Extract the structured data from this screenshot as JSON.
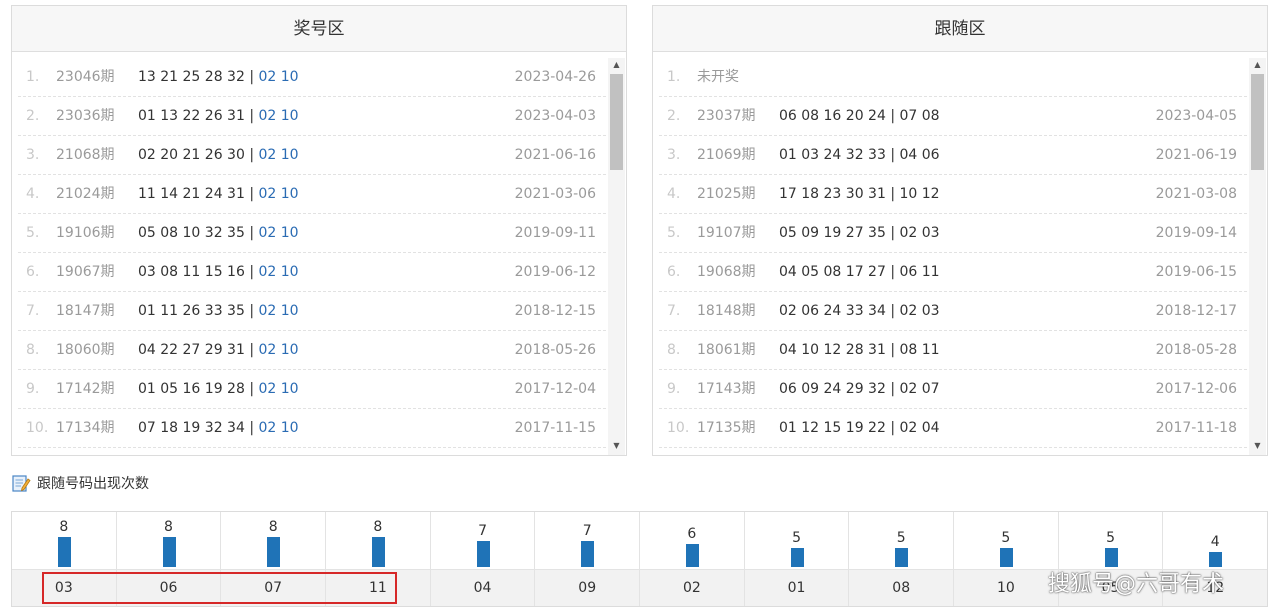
{
  "left_panel": {
    "title": "奖号区",
    "rows": [
      {
        "idx": "1.",
        "issue": "23046期",
        "front": "13 21 25 28 32 | ",
        "back": "02 10",
        "date": "2023-04-26"
      },
      {
        "idx": "2.",
        "issue": "23036期",
        "front": "01 13 22 26 31 | ",
        "back": "02 10",
        "date": "2023-04-03"
      },
      {
        "idx": "3.",
        "issue": "21068期",
        "front": "02 20 21 26 30 | ",
        "back": "02 10",
        "date": "2021-06-16"
      },
      {
        "idx": "4.",
        "issue": "21024期",
        "front": "11 14 21 24 31 | ",
        "back": "02 10",
        "date": "2021-03-06"
      },
      {
        "idx": "5.",
        "issue": "19106期",
        "front": "05 08 10 32 35 | ",
        "back": "02 10",
        "date": "2019-09-11"
      },
      {
        "idx": "6.",
        "issue": "19067期",
        "front": "03 08 11 15 16 | ",
        "back": "02 10",
        "date": "2019-06-12"
      },
      {
        "idx": "7.",
        "issue": "18147期",
        "front": "01 11 26 33 35 | ",
        "back": "02 10",
        "date": "2018-12-15"
      },
      {
        "idx": "8.",
        "issue": "18060期",
        "front": "04 22 27 29 31 | ",
        "back": "02 10",
        "date": "2018-05-26"
      },
      {
        "idx": "9.",
        "issue": "17142期",
        "front": "01 05 16 19 28 | ",
        "back": "02 10",
        "date": "2017-12-04"
      },
      {
        "idx": "10.",
        "issue": "17134期",
        "front": "07 18 19 32 34 | ",
        "back": "02 10",
        "date": "2017-11-15"
      }
    ]
  },
  "right_panel": {
    "title": "跟随区",
    "pending_row": {
      "idx": "1.",
      "text": "未开奖"
    },
    "rows": [
      {
        "idx": "2.",
        "issue": "23037期",
        "numbers": "06 08 16 20 24 | 07 08",
        "date": "2023-04-05"
      },
      {
        "idx": "3.",
        "issue": "21069期",
        "numbers": "01 03 24 32 33 | 04 06",
        "date": "2021-06-19"
      },
      {
        "idx": "4.",
        "issue": "21025期",
        "numbers": "17 18 23 30 31 | 10 12",
        "date": "2021-03-08"
      },
      {
        "idx": "5.",
        "issue": "19107期",
        "numbers": "05 09 19 27 35 | 02 03",
        "date": "2019-09-14"
      },
      {
        "idx": "6.",
        "issue": "19068期",
        "numbers": "04 05 08 17 27 | 06 11",
        "date": "2019-06-15"
      },
      {
        "idx": "7.",
        "issue": "18148期",
        "numbers": "02 06 24 33 34 | 02 03",
        "date": "2018-12-17"
      },
      {
        "idx": "8.",
        "issue": "18061期",
        "numbers": "04 10 12 28 31 | 08 11",
        "date": "2018-05-28"
      },
      {
        "idx": "9.",
        "issue": "17143期",
        "numbers": "06 09 24 29 32 | 02 07",
        "date": "2017-12-06"
      },
      {
        "idx": "10.",
        "issue": "17135期",
        "numbers": "01 12 15 19 22 | 02 04",
        "date": "2017-11-18"
      }
    ]
  },
  "section": {
    "title": "跟随号码出现次数",
    "icon": "edit-note-icon"
  },
  "frequency": [
    {
      "number": "03",
      "count": "8",
      "value": 8
    },
    {
      "number": "06",
      "count": "8",
      "value": 8
    },
    {
      "number": "07",
      "count": "8",
      "value": 8
    },
    {
      "number": "11",
      "count": "8",
      "value": 8
    },
    {
      "number": "04",
      "count": "7",
      "value": 7
    },
    {
      "number": "09",
      "count": "7",
      "value": 7
    },
    {
      "number": "02",
      "count": "6",
      "value": 6
    },
    {
      "number": "01",
      "count": "5",
      "value": 5
    },
    {
      "number": "08",
      "count": "5",
      "value": 5
    },
    {
      "number": "10",
      "count": "5",
      "value": 5
    },
    {
      "number": "05",
      "count": "5",
      "value": 5
    },
    {
      "number": "12",
      "count": "4",
      "value": 4
    }
  ],
  "colors": {
    "bar": "#1f73b7",
    "back_numbers": "#2a6bb3",
    "highlight": "#d62828"
  },
  "watermark": "搜狐号@六哥有术"
}
